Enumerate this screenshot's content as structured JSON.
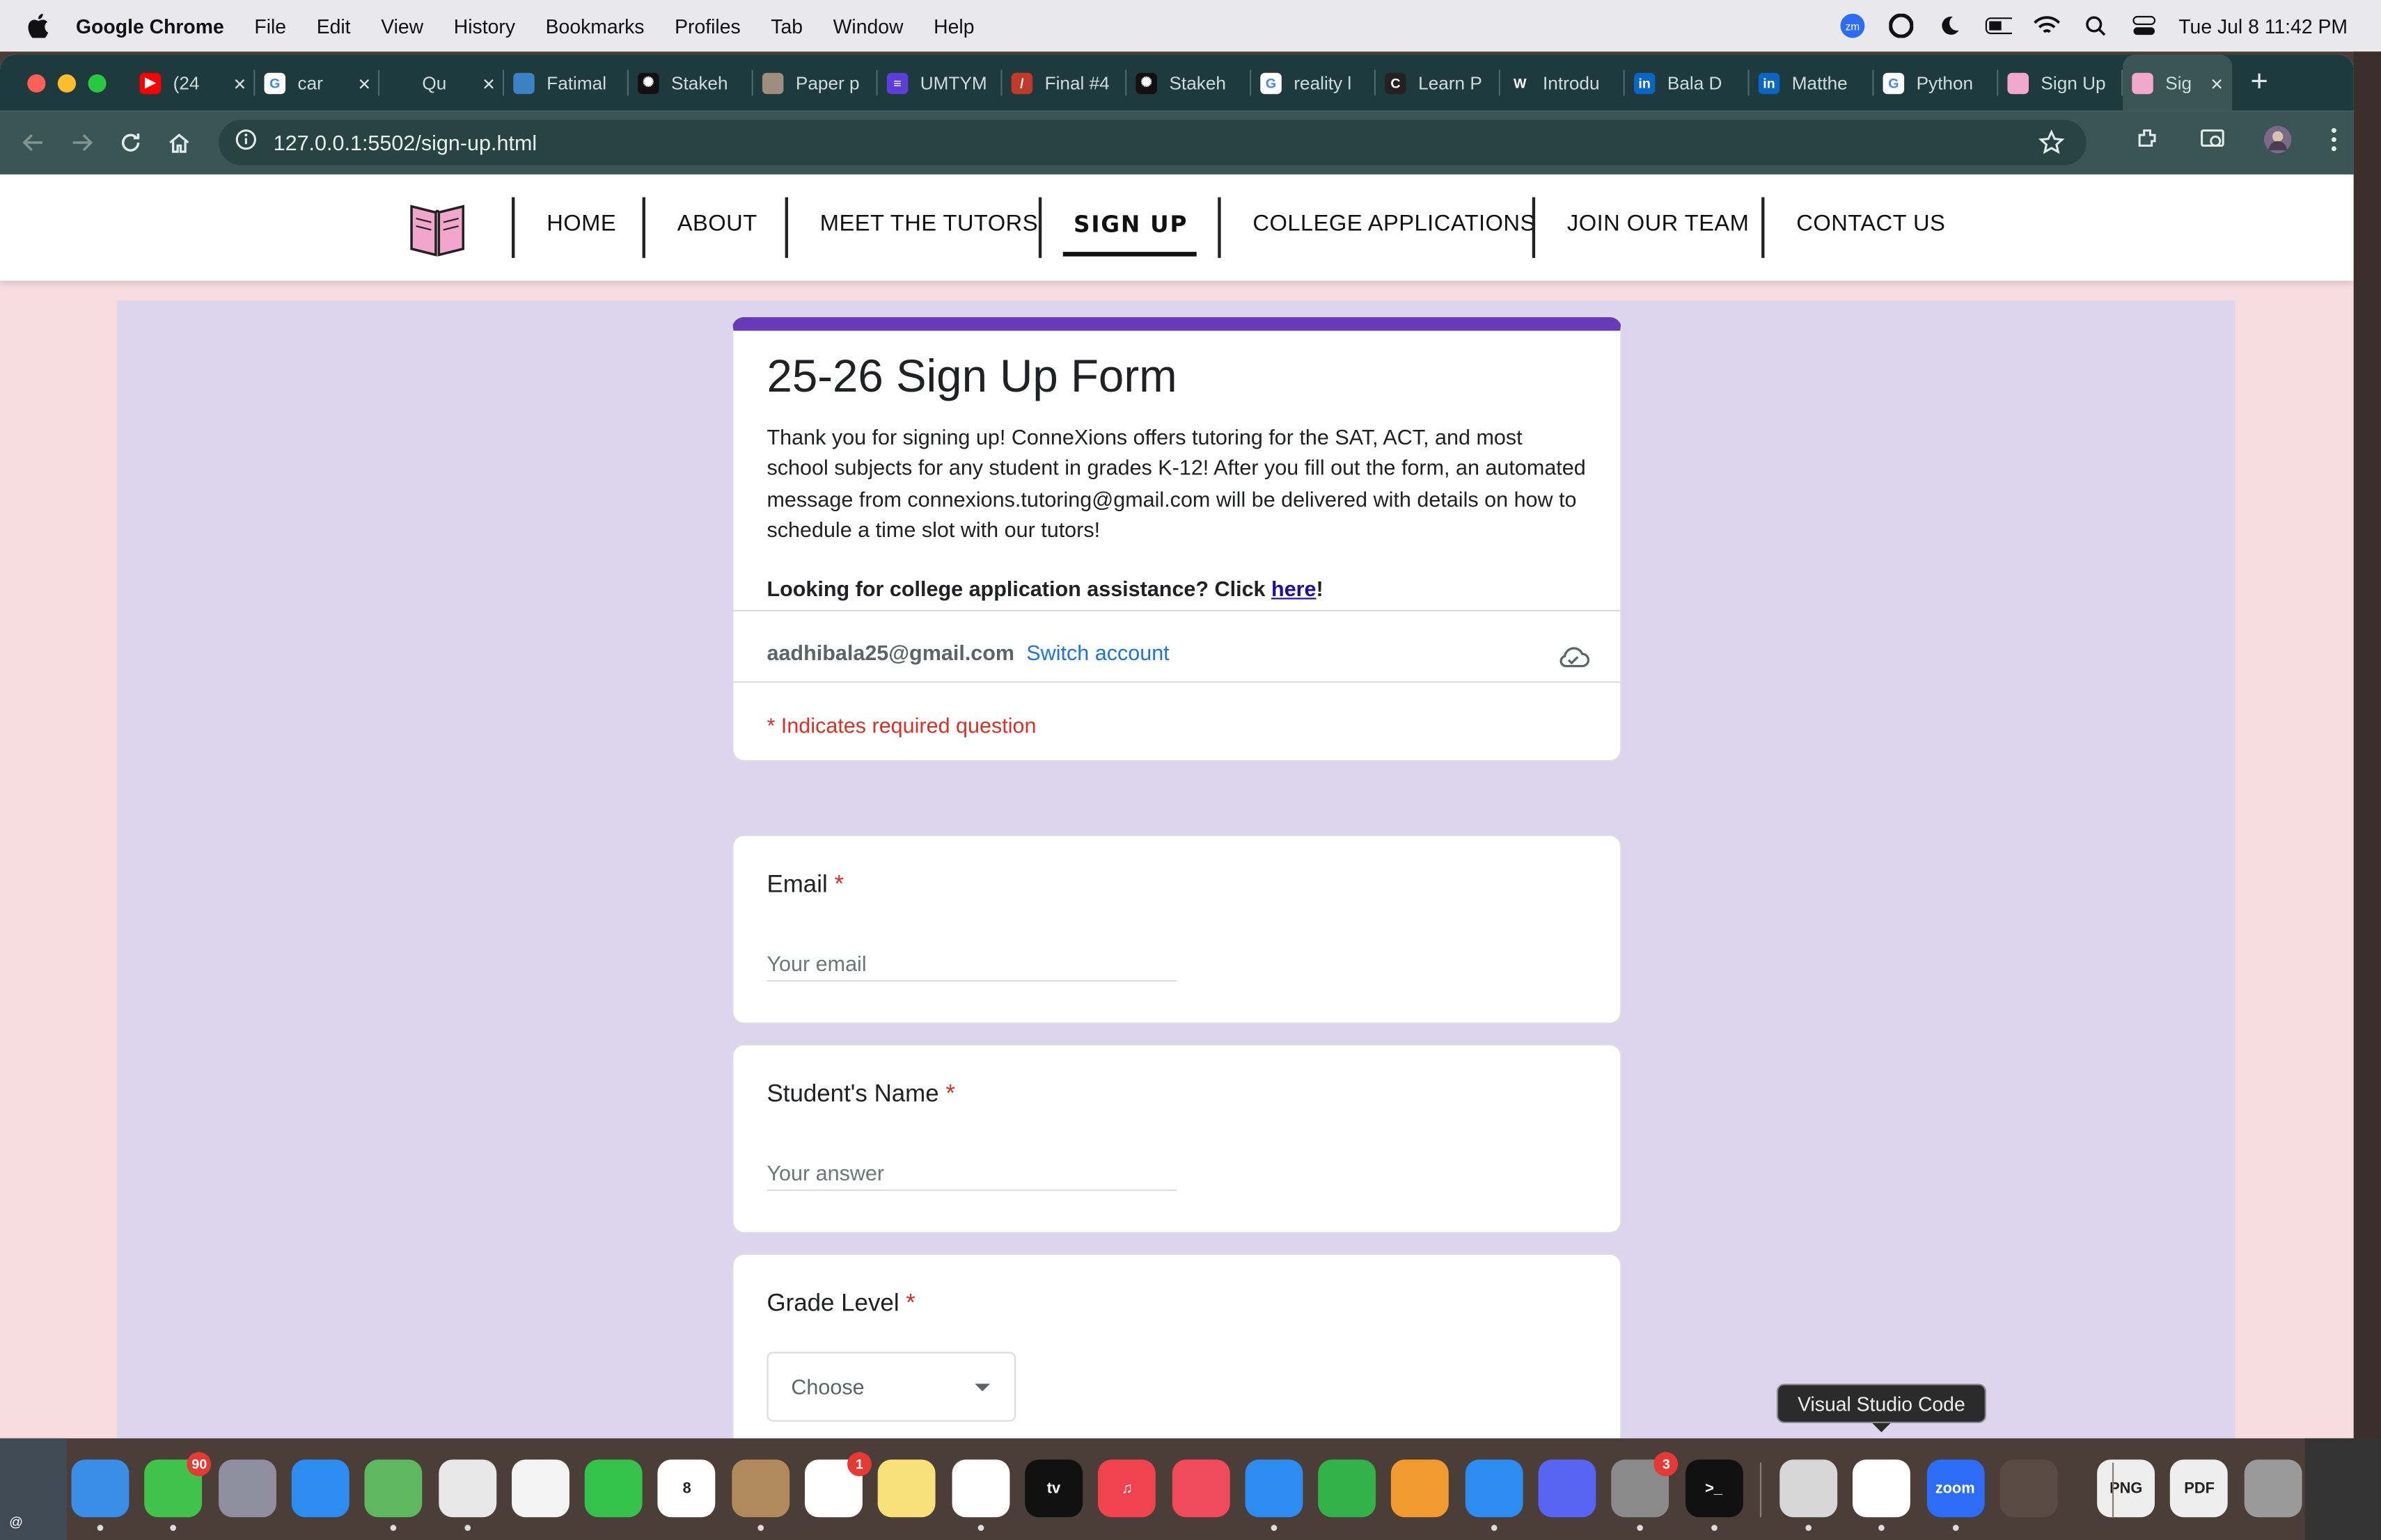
{
  "menubar": {
    "app_name": "Google Chrome",
    "items": [
      "File",
      "Edit",
      "View",
      "History",
      "Bookmarks",
      "Profiles",
      "Tab",
      "Window",
      "Help"
    ],
    "clock": "Tue Jul 8  11:42 PM"
  },
  "tabs": [
    {
      "label": "(24",
      "fav_color": "#ff0000",
      "fav_glyph": "▶"
    },
    {
      "label": "car",
      "fav_color": "#ffffff",
      "fav_glyph": "G"
    },
    {
      "label": "Qu",
      "fav_color": "#1f3a3c",
      "fav_glyph": ""
    },
    {
      "label": "Fatimal",
      "fav_color": "#3b82c4",
      "fav_glyph": ""
    },
    {
      "label": "Stakeh",
      "fav_color": "#111111",
      "fav_glyph": "✺"
    },
    {
      "label": "Paper p",
      "fav_color": "#9e8e80",
      "fav_glyph": ""
    },
    {
      "label": "UMTYM",
      "fav_color": "#5b3fd6",
      "fav_glyph": "≡"
    },
    {
      "label": "Final #4",
      "fav_color": "#c0392b",
      "fav_glyph": "/"
    },
    {
      "label": "Stakeh",
      "fav_color": "#111111",
      "fav_glyph": "✺"
    },
    {
      "label": "reality l",
      "fav_color": "#ffffff",
      "fav_glyph": "G"
    },
    {
      "label": "Learn P",
      "fav_color": "#222222",
      "fav_glyph": "C"
    },
    {
      "label": "Introdu",
      "fav_color": "#1f3a3c",
      "fav_glyph": "W"
    },
    {
      "label": "Bala D",
      "fav_color": "#0a66c2",
      "fav_glyph": "in"
    },
    {
      "label": "Matthe",
      "fav_color": "#0a66c2",
      "fav_glyph": "in"
    },
    {
      "label": "Python",
      "fav_color": "#ffffff",
      "fav_glyph": "G"
    },
    {
      "label": "Sign Up",
      "fav_color": "#f0a8cc",
      "fav_glyph": ""
    }
  ],
  "active_tab": {
    "label": "Sig",
    "close": "×"
  },
  "tab_close": "×",
  "new_tab": "+",
  "address": {
    "url": "127.0.0.1:5502/sign-up.html"
  },
  "nav": {
    "items": [
      "HOME",
      "ABOUT",
      "MEET THE TUTORS",
      "SIGN UP",
      "COLLEGE APPLICATIONS",
      "JOIN OUR TEAM",
      "CONTACT US"
    ],
    "active": "SIGN UP"
  },
  "form": {
    "title": "25-26 Sign Up Form",
    "description": "Thank you for signing up! ConneXions offers tutoring for the SAT, ACT, and most school subjects for any student in grades K-12! After you fill out the form, an automated message from connexions.tutoring@gmail.com will be delivered with details on how to schedule a time slot with our tutors!",
    "college_prompt": "Looking for college application assistance? Click ",
    "college_link": "here",
    "college_suffix": "!",
    "account_email": "aadhibala25@gmail.com",
    "switch_account": "Switch account",
    "required_note": "* Indicates required question",
    "questions": [
      {
        "title": "Email",
        "required_mark": "*",
        "placeholder": "Your email"
      },
      {
        "title": "Student's Name",
        "required_mark": "*",
        "placeholder": "Your answer"
      },
      {
        "title": "Grade Level",
        "required_mark": "*",
        "selected": "Choose"
      }
    ]
  },
  "tooltip": "Visual Studio Code",
  "dock": {
    "apps": [
      {
        "name": "Finder",
        "color": "#3a8ee6",
        "label": ""
      },
      {
        "name": "Messages",
        "color": "#3fc34a",
        "label": "",
        "badge": "90"
      },
      {
        "name": "Launchpad",
        "color": "#8f8fa0",
        "label": ""
      },
      {
        "name": "Safari",
        "color": "#2d8cf0",
        "label": ""
      },
      {
        "name": "Maps",
        "color": "#5fb85f",
        "label": ""
      },
      {
        "name": "Chrome",
        "color": "#e8e8e8",
        "label": ""
      },
      {
        "name": "Photos",
        "color": "#f4f4f4",
        "label": ""
      },
      {
        "name": "FaceTime",
        "color": "#35c24a",
        "label": ""
      },
      {
        "name": "Calendar",
        "color": "#ffffff",
        "label": "8"
      },
      {
        "name": "Contacts",
        "color": "#b08a5a",
        "label": ""
      },
      {
        "name": "Reminders",
        "color": "#ffffff",
        "label": "",
        "badge": "1"
      },
      {
        "name": "Notes",
        "color": "#f7e27a",
        "label": ""
      },
      {
        "name": "Freeform",
        "color": "#ffffff",
        "label": ""
      },
      {
        "name": "TV",
        "color": "#111111",
        "label": "tv"
      },
      {
        "name": "Music",
        "color": "#f0434f",
        "label": "♫"
      },
      {
        "name": "News",
        "color": "#f14a5b",
        "label": ""
      },
      {
        "name": "Keynote",
        "color": "#2d8cf0",
        "label": ""
      },
      {
        "name": "Numbers",
        "color": "#33b24a",
        "label": ""
      },
      {
        "name": "Pages",
        "color": "#f09a30",
        "label": ""
      },
      {
        "name": "App Store",
        "color": "#2d8cf0",
        "label": ""
      },
      {
        "name": "Discord",
        "color": "#5865f2",
        "label": ""
      },
      {
        "name": "System Settings",
        "color": "#8a8a8a",
        "label": "",
        "badge": "3"
      },
      {
        "name": "Terminal",
        "color": "#111111",
        "label": ">_"
      },
      {
        "name": "Preview",
        "color": "#d7d7d7",
        "label": ""
      },
      {
        "name": "Visual Studio Code",
        "color": "#ffffff",
        "label": ""
      },
      {
        "name": "Zoom",
        "color": "#2d6cf6",
        "label": "zoom"
      },
      {
        "name": "Rocket",
        "color": "#5a4a44",
        "label": ""
      },
      {
        "name": "PNG file",
        "color": "#eeeeee",
        "label": "PNG"
      },
      {
        "name": "PDF file",
        "color": "#eeeeee",
        "label": "PDF"
      },
      {
        "name": "Trash",
        "color": "#9a9a9a",
        "label": ""
      }
    ]
  }
}
